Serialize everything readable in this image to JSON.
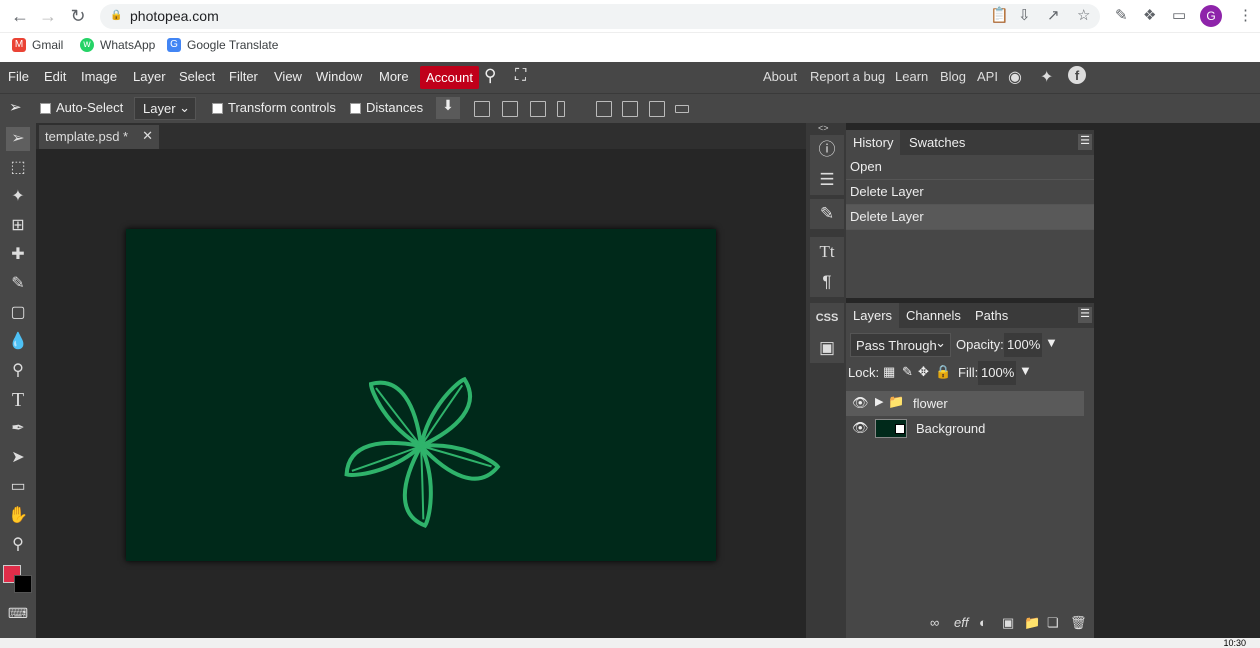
{
  "browser": {
    "url": "photopea.com",
    "profile_initial": "G"
  },
  "bookmarks": [
    {
      "label": "Gmail",
      "color": "#ea4335",
      "icon": "gmail-icon"
    },
    {
      "label": "WhatsApp",
      "color": "#25d366",
      "icon": "whatsapp-icon"
    },
    {
      "label": "Google Translate",
      "color": "#4285f4",
      "icon": "translate-icon"
    }
  ],
  "menu": {
    "items": [
      "File",
      "Edit",
      "Image",
      "Layer",
      "Select",
      "Filter",
      "View",
      "Window",
      "More"
    ],
    "account": "Account",
    "right": [
      "About",
      "Report a bug",
      "Learn",
      "Blog",
      "API"
    ]
  },
  "options": {
    "auto_select": "Auto-Select",
    "layer_select": "Layer",
    "transform": "Transform controls",
    "distances": "Distances"
  },
  "document": {
    "tab": "template.psd *",
    "canvas_color": "#00291a",
    "art_color": "#2fb36b"
  },
  "history": {
    "tabs": [
      "History",
      "Swatches"
    ],
    "items": [
      "Open",
      "Delete Layer",
      "Delete Layer"
    ]
  },
  "layers": {
    "tabs": [
      "Layers",
      "Channels",
      "Paths"
    ],
    "blend": "Pass Through",
    "opacity_label": "Opacity:",
    "opacity": "100%",
    "lock_label": "Lock:",
    "fill_label": "Fill:",
    "fill": "100%",
    "items": [
      "flower",
      "Background"
    ]
  },
  "dock": {
    "css": "CSS"
  },
  "colors": {
    "foreground": "#e02d49",
    "background": "#000000",
    "accent": "#c0001a"
  },
  "taskbar": {
    "clock": "10:30"
  }
}
